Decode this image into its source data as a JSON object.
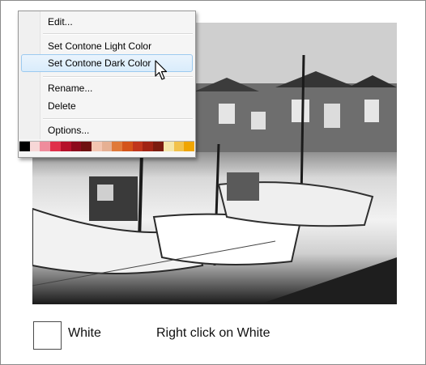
{
  "menu": {
    "items": [
      {
        "label": "Edit...",
        "highlighted": false
      },
      {
        "label": "Set Contone Light Color",
        "highlighted": false
      },
      {
        "label": "Set Contone Dark Color",
        "highlighted": true
      },
      {
        "label": "Rename...",
        "highlighted": false
      },
      {
        "label": "Delete",
        "highlighted": false
      },
      {
        "label": "Options...",
        "highlighted": false
      }
    ],
    "palette": [
      "#000000",
      "#f7d7d7",
      "#ef8c9c",
      "#e0304a",
      "#b5102a",
      "#8c0a1c",
      "#6e1010",
      "#f3c5b0",
      "#e6b093",
      "#e07a3a",
      "#d4541a",
      "#c0361c",
      "#a02414",
      "#7b1c0f",
      "#f5e6a8",
      "#f2c24a",
      "#f0a500"
    ]
  },
  "footer": {
    "swatch_label": "White",
    "instruction": "Right click on White"
  },
  "colors": {
    "highlight": "#d9ecfb",
    "highlight_border": "#9ccaf0"
  },
  "icons": [
    "arrow-cursor-icon"
  ]
}
